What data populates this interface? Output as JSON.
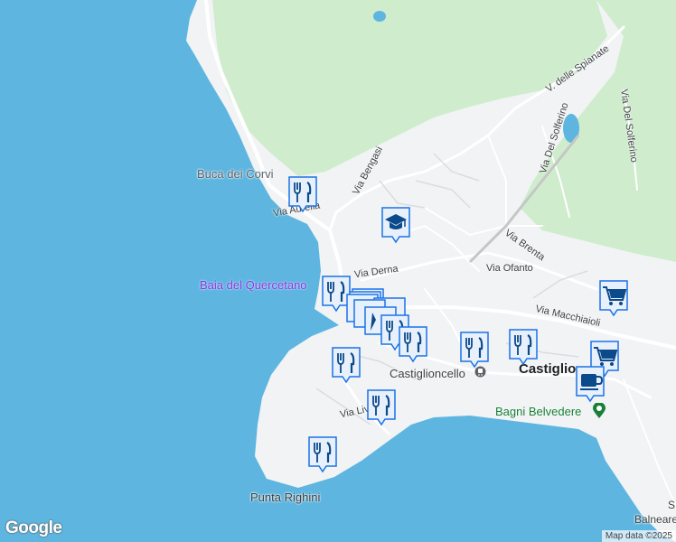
{
  "labels": {
    "buca_dei_corvi": "Buca dei Corvi",
    "via_aurelia": "Via Aurelia",
    "via_bengasi": "Via Bengasi",
    "via_delle_spianate": "V. delle Spianate",
    "via_del_solferino_1": "Via Del Solferino",
    "via_del_solferino_2": "Via Del Solferino",
    "via_brenta": "Via Brenta",
    "via_ofanto": "Via Ofanto",
    "via_derna": "Via Derna",
    "via_macchiaioli": "Via Macchiaioli",
    "baia_del_quercetano": "Baia del Quercetano",
    "castiglioncello": "Castiglioncello",
    "castiglioncello_town": "Castiglio",
    "via_livorno": "Via Liv",
    "bagni_belvedere": "Bagni Belvedere",
    "punta_righini": "Punta Righini",
    "edge_s": "S",
    "edge_balneare": "Balneare"
  },
  "attribution": {
    "logo": "Google",
    "copyright": "Map data ©2025"
  },
  "markers": [
    {
      "name": "restaurant-marker-1",
      "icon": "fork-knife-icon"
    },
    {
      "name": "school-marker",
      "icon": "graduation-cap-icon"
    },
    {
      "name": "restaurant-marker-2",
      "icon": "fork-knife-icon"
    },
    {
      "name": "marker-cluster",
      "icon": "stacked-markers-icon"
    },
    {
      "name": "restaurant-marker-3",
      "icon": "fork-knife-icon"
    },
    {
      "name": "restaurant-marker-4",
      "icon": "fork-knife-icon"
    },
    {
      "name": "restaurant-marker-5",
      "icon": "fork-knife-icon"
    },
    {
      "name": "restaurant-marker-6",
      "icon": "fork-knife-icon"
    },
    {
      "name": "restaurant-marker-7",
      "icon": "fork-knife-icon"
    },
    {
      "name": "restaurant-marker-8",
      "icon": "fork-knife-icon"
    },
    {
      "name": "restaurant-marker-9",
      "icon": "fork-knife-icon"
    },
    {
      "name": "shopping-cart-marker-1",
      "icon": "shopping-cart-icon"
    },
    {
      "name": "shopping-cart-marker-2",
      "icon": "shopping-cart-icon"
    },
    {
      "name": "cafe-marker",
      "icon": "coffee-cup-icon"
    }
  ],
  "colors": {
    "water": "#5eb6e0",
    "land": "#f1f3f4",
    "park": "#cfeccd",
    "marker_fill": "#e8f1fb",
    "marker_border": "#1a73e8",
    "icon_color": "#0b4a8b"
  }
}
